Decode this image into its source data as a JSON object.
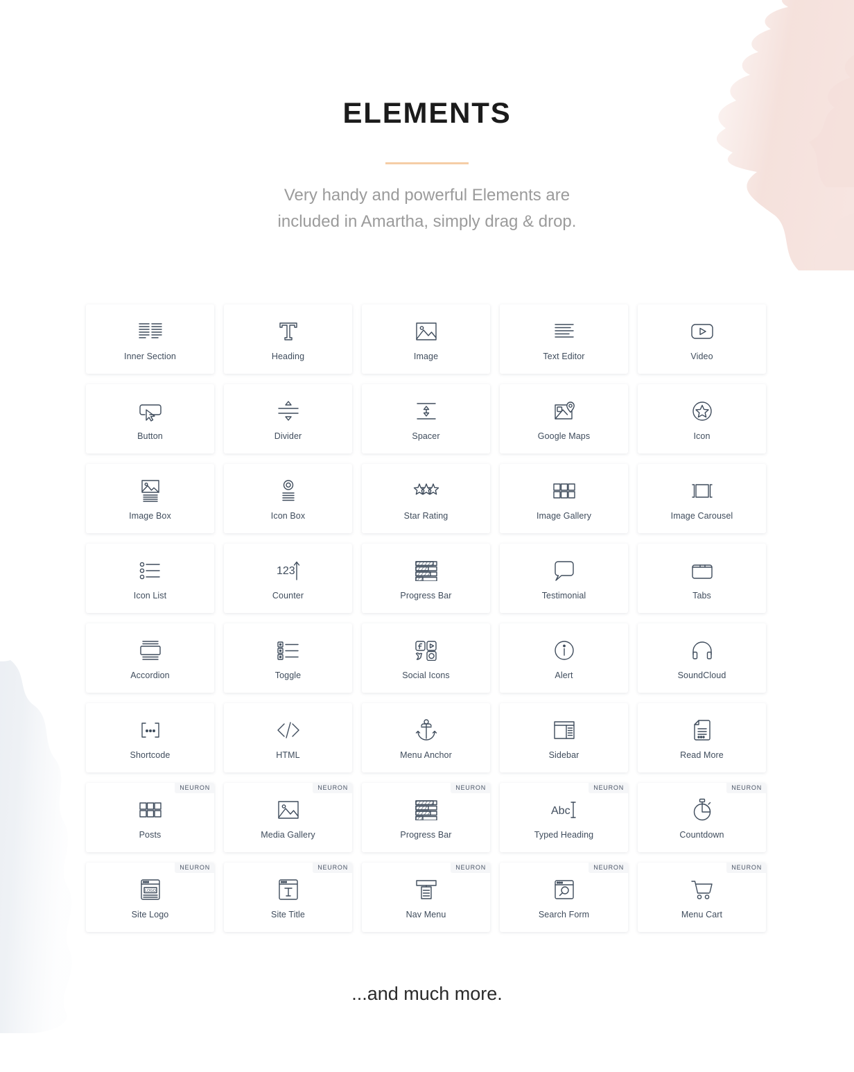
{
  "header": {
    "title": "ELEMENTS",
    "subtitle_line1": "Very handy and powerful Elements are",
    "subtitle_line2": "included in Amartha, simply drag & drop.",
    "rule_color": "#f5cda6"
  },
  "footer": {
    "note": "...and much more."
  },
  "theme": {
    "icon_color": "#3f4c5c",
    "text_color": "#3f4c5c",
    "badge_bg": "#f5f6f8",
    "card_bg": "#ffffff",
    "page_bg": "#ffffff",
    "deco_pink": "#f6e0dc",
    "deco_gray": "#e8ebf0"
  },
  "grid": {
    "columns": 5,
    "rows": 8,
    "badge_label": "NEURON",
    "cards": [
      {
        "label": "Inner Section",
        "icon": "inner-section-icon",
        "badge": null
      },
      {
        "label": "Heading",
        "icon": "heading-t-icon",
        "badge": null
      },
      {
        "label": "Image",
        "icon": "image-icon",
        "badge": null
      },
      {
        "label": "Text Editor",
        "icon": "text-editor-icon",
        "badge": null
      },
      {
        "label": "Video",
        "icon": "video-play-icon",
        "badge": null
      },
      {
        "label": "Button",
        "icon": "button-cursor-icon",
        "badge": null
      },
      {
        "label": "Divider",
        "icon": "divider-icon",
        "badge": null
      },
      {
        "label": "Spacer",
        "icon": "spacer-icon",
        "badge": null
      },
      {
        "label": "Google Maps",
        "icon": "google-maps-icon",
        "badge": null
      },
      {
        "label": "Icon",
        "icon": "star-circle-icon",
        "badge": null
      },
      {
        "label": "Image Box",
        "icon": "image-box-icon",
        "badge": null
      },
      {
        "label": "Icon Box",
        "icon": "icon-box-icon",
        "badge": null
      },
      {
        "label": "Star Rating",
        "icon": "star-rating-icon",
        "badge": null
      },
      {
        "label": "Image Gallery",
        "icon": "gallery-grid-icon",
        "badge": null
      },
      {
        "label": "Image Carousel",
        "icon": "carousel-icon",
        "badge": null
      },
      {
        "label": "Icon List",
        "icon": "icon-list-icon",
        "badge": null
      },
      {
        "label": "Counter",
        "icon": "counter-123-icon",
        "badge": null
      },
      {
        "label": "Progress Bar",
        "icon": "progress-bar-icon",
        "badge": null
      },
      {
        "label": "Testimonial",
        "icon": "speech-bubble-icon",
        "badge": null
      },
      {
        "label": "Tabs",
        "icon": "tabs-folder-icon",
        "badge": null
      },
      {
        "label": "Accordion",
        "icon": "accordion-icon",
        "badge": null
      },
      {
        "label": "Toggle",
        "icon": "toggle-list-icon",
        "badge": null
      },
      {
        "label": "Social Icons",
        "icon": "social-icons-icon",
        "badge": null
      },
      {
        "label": "Alert",
        "icon": "info-circle-icon",
        "badge": null
      },
      {
        "label": "SoundCloud",
        "icon": "headphones-icon",
        "badge": null
      },
      {
        "label": "Shortcode",
        "icon": "shortcode-icon",
        "badge": null
      },
      {
        "label": "HTML",
        "icon": "code-brackets-icon",
        "badge": null
      },
      {
        "label": "Menu Anchor",
        "icon": "anchor-icon",
        "badge": null
      },
      {
        "label": "Sidebar",
        "icon": "sidebar-icon",
        "badge": null
      },
      {
        "label": "Read More",
        "icon": "document-icon",
        "badge": null
      },
      {
        "label": "Posts",
        "icon": "gallery-grid-icon",
        "badge": "NEURON"
      },
      {
        "label": "Media Gallery",
        "icon": "image-icon",
        "badge": "NEURON"
      },
      {
        "label": "Progress Bar",
        "icon": "progress-bar-icon",
        "badge": "NEURON"
      },
      {
        "label": "Typed Heading",
        "icon": "typed-heading-icon",
        "badge": "NEURON"
      },
      {
        "label": "Countdown",
        "icon": "stopwatch-icon",
        "badge": "NEURON"
      },
      {
        "label": "Site Logo",
        "icon": "site-logo-icon",
        "badge": "NEURON"
      },
      {
        "label": "Site Title",
        "icon": "site-title-icon",
        "badge": "NEURON"
      },
      {
        "label": "Nav Menu",
        "icon": "nav-menu-icon",
        "badge": "NEURON"
      },
      {
        "label": "Search Form",
        "icon": "search-form-icon",
        "badge": "NEURON"
      },
      {
        "label": "Menu Cart",
        "icon": "shopping-cart-icon",
        "badge": "NEURON"
      }
    ]
  }
}
